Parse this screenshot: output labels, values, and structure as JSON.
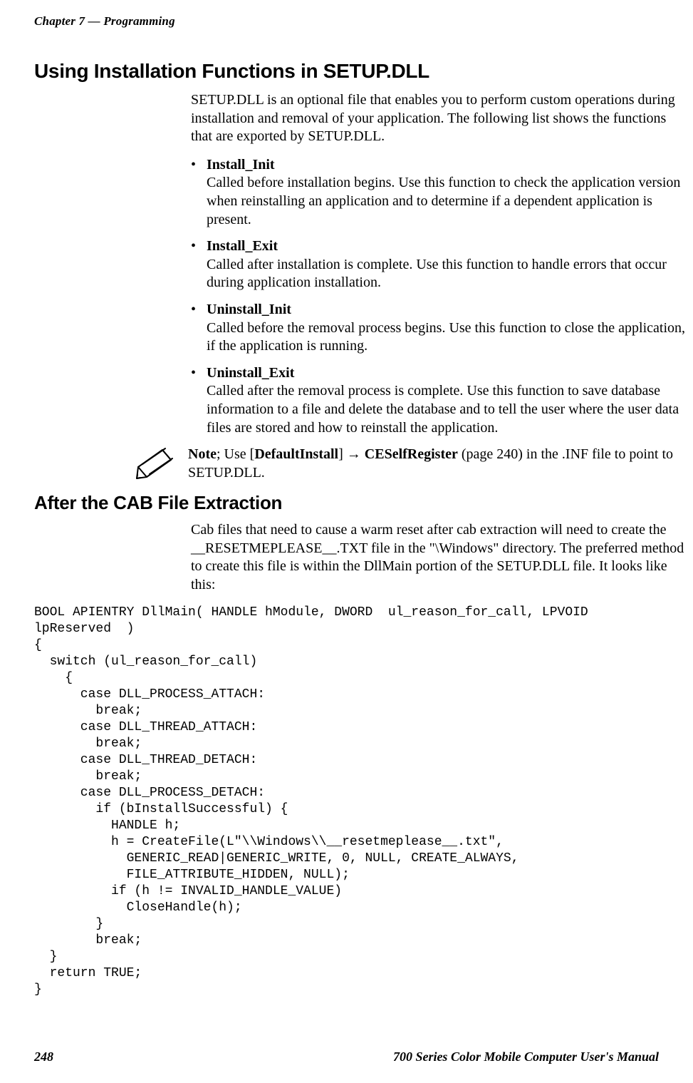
{
  "header": {
    "chapter_label": "Chapter 7",
    "separator": " —  ",
    "section_label": "Programming"
  },
  "h1": "Using Installation Functions in SETUP.DLL",
  "intro": "SETUP.DLL is an optional file that enables you to perform custom operations during installation and removal of your application. The following list shows the functions that are exported by SETUP.DLL.",
  "bullets": [
    {
      "title": "Install_Init",
      "desc": "Called before installation begins. Use this function to check the application version when reinstalling an application and to determine if a dependent application is present."
    },
    {
      "title": "Install_Exit",
      "desc": "Called after installation is complete. Use this function to handle errors that occur during application installation."
    },
    {
      "title": "Uninstall_Init",
      "desc": "Called before the removal process begins. Use this function to close the application, if the application is running."
    },
    {
      "title": "Uninstall_Exit",
      "desc": "Called after the removal process is complete. Use this function to save database information to a file and delete the database and to tell the user where the user data files are stored and how to reinstall the application."
    }
  ],
  "note": {
    "lead": "Note",
    "sep": "; Use [",
    "defaultinstall": "DefaultInstall",
    "mid": "] ",
    "arrow": "→",
    "space": " ",
    "ceself": "CESelfRegister",
    "tail": " (page 240) in the .INF file to point to SETUP.DLL."
  },
  "h2": "After the CAB File Extraction",
  "after_para": "Cab files that need to cause a warm reset after cab extraction will need to create the __RESETMEPLEASE__.TXT file in the \"\\Windows\" directory. The preferred method to create this file is within the DllMain portion of the SETUP.DLL file. It looks like this:",
  "code": "BOOL APIENTRY DllMain( HANDLE hModule, DWORD  ul_reason_for_call, LPVOID\nlpReserved  )\n{\n  switch (ul_reason_for_call)\n    {\n      case DLL_PROCESS_ATTACH:\n        break;\n      case DLL_THREAD_ATTACH:\n        break;\n      case DLL_THREAD_DETACH:\n        break;\n      case DLL_PROCESS_DETACH:\n        if (bInstallSuccessful) {\n          HANDLE h;\n          h = CreateFile(L\"\\\\Windows\\\\__resetmeplease__.txt\",\n            GENERIC_READ|GENERIC_WRITE, 0, NULL, CREATE_ALWAYS,\n            FILE_ATTRIBUTE_HIDDEN, NULL);\n          if (h != INVALID_HANDLE_VALUE)\n            CloseHandle(h);\n        }\n        break;\n  }\n  return TRUE;\n}",
  "footer": {
    "page": "248",
    "title": "700 Series Color Mobile Computer User's Manual"
  }
}
